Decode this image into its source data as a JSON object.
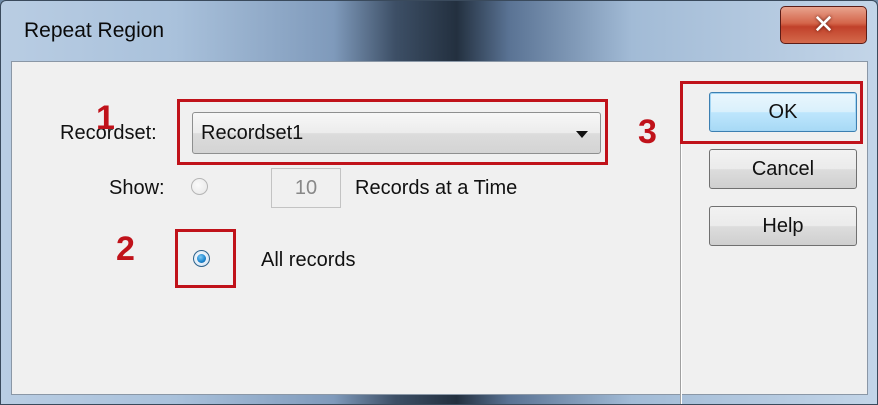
{
  "window": {
    "title": "Repeat Region",
    "close_symbol": "✕"
  },
  "form": {
    "recordset_label": "Recordset:",
    "recordset_value": "Recordset1",
    "show_label": "Show:",
    "records_count": "10",
    "records_at_a_time_label": "Records at a Time",
    "all_records_label": "All records",
    "selected_option": "All records"
  },
  "buttons": {
    "ok": "OK",
    "cancel": "Cancel",
    "help": "Help"
  },
  "annotations": {
    "one": "1",
    "two": "2",
    "three": "3"
  },
  "colors": {
    "annotation": "#c0121a",
    "default_button": "#3c7fb1",
    "close_button": "#c1412a"
  }
}
